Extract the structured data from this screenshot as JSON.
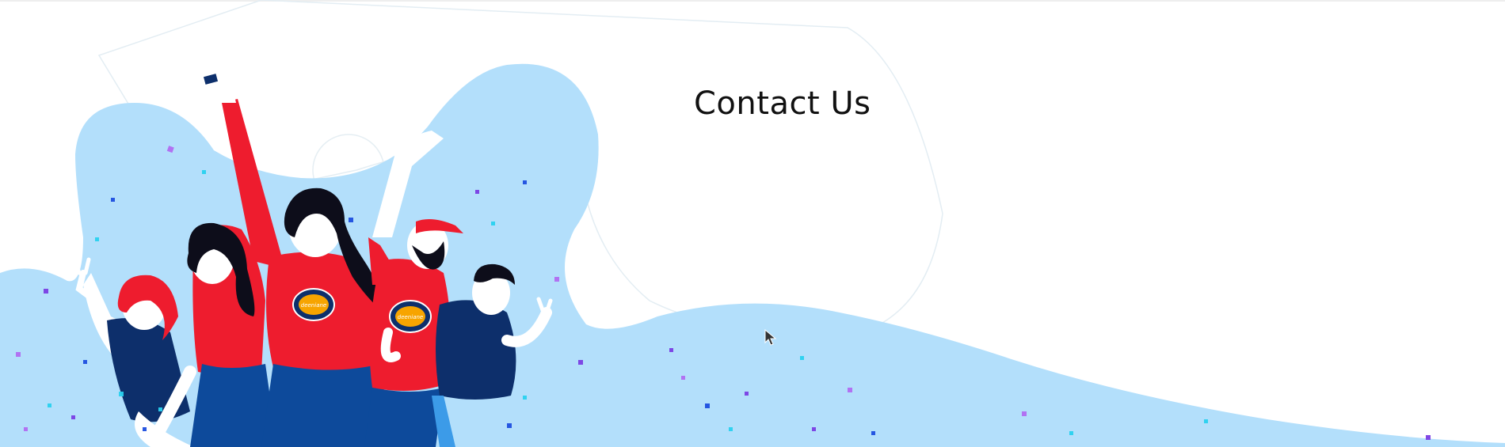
{
  "page": {
    "title": "Contact Us",
    "cursor_icon": "arrow-cursor-icon"
  },
  "hero": {
    "illustration": "group-of-people-celebrating",
    "badge_text": "deeniane pizza"
  },
  "colors": {
    "sky_blob": "#b3dffb",
    "shirt_red": "#ee1c2e",
    "navy": "#0d2f6b",
    "skin": "#ffffff",
    "confetti": [
      "#7b3fe4",
      "#2ad1f0",
      "#1e4fe0",
      "#b26cf2"
    ]
  }
}
